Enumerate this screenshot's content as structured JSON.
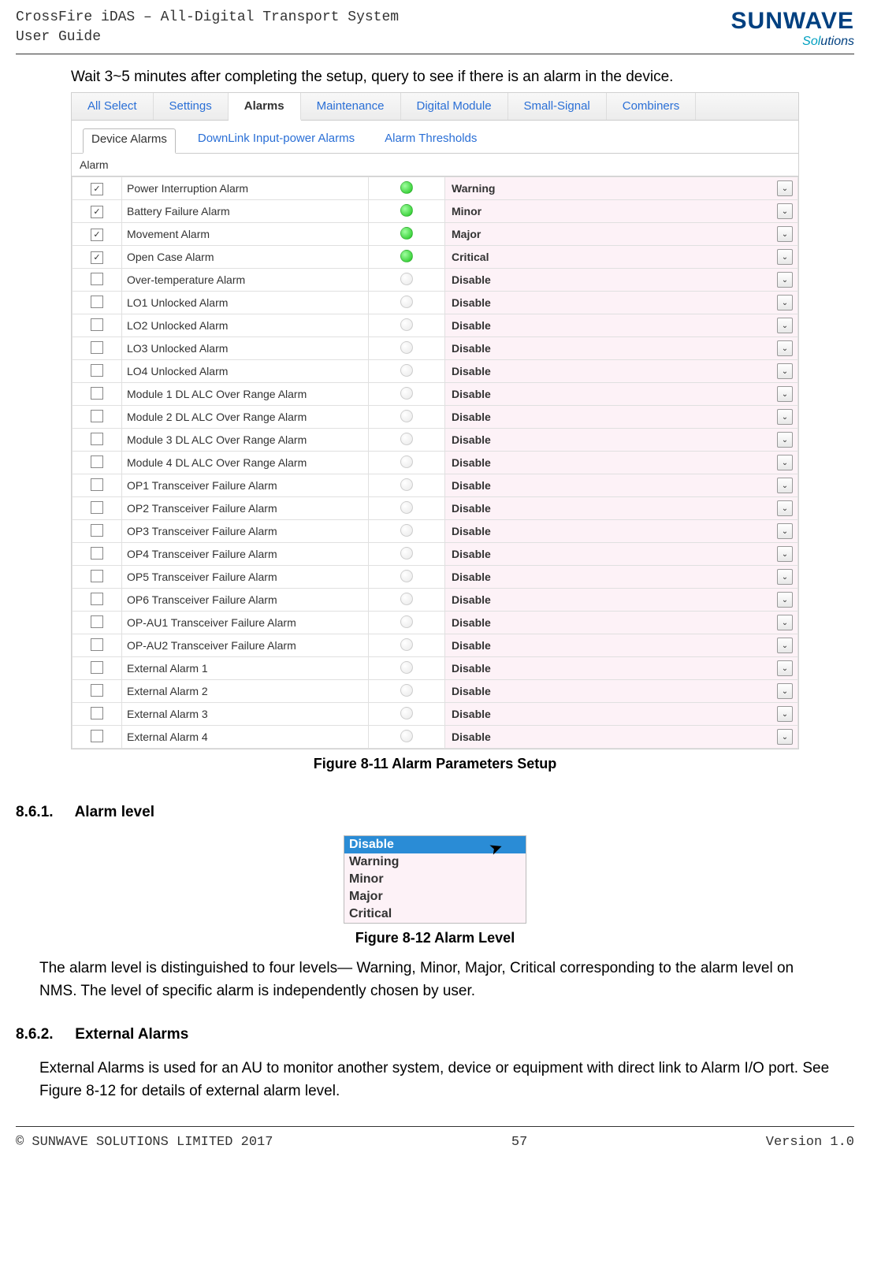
{
  "header": {
    "line1": "CrossFire iDAS – All-Digital Transport System",
    "line2": "User Guide",
    "logo_main": "SUNWAVE",
    "logo_sub_a": "Sol",
    "logo_sub_b": "utions"
  },
  "intro": "Wait 3~5 minutes after completing the setup, query to see if there is an alarm in the device.",
  "tabs": {
    "all_select": "All Select",
    "settings": "Settings",
    "alarms": "Alarms",
    "maintenance": "Maintenance",
    "digital_module": "Digital Module",
    "small_signal": "Small-Signal",
    "combiners": "Combiners"
  },
  "subtabs": {
    "device_alarms": "Device Alarms",
    "downlink": "DownLink Input-power Alarms",
    "thresholds": "Alarm Thresholds"
  },
  "alarm_section_label": "Alarm",
  "alarms": [
    {
      "checked": true,
      "name": "Power Interruption Alarm",
      "led": "green",
      "level": "Warning"
    },
    {
      "checked": true,
      "name": "Battery Failure Alarm",
      "led": "green",
      "level": "Minor"
    },
    {
      "checked": true,
      "name": "Movement Alarm",
      "led": "green",
      "level": "Major"
    },
    {
      "checked": true,
      "name": "Open Case Alarm",
      "led": "green",
      "level": "Critical"
    },
    {
      "checked": false,
      "name": "Over-temperature Alarm",
      "led": "off",
      "level": "Disable"
    },
    {
      "checked": false,
      "name": "LO1 Unlocked Alarm",
      "led": "off",
      "level": "Disable"
    },
    {
      "checked": false,
      "name": "LO2 Unlocked Alarm",
      "led": "off",
      "level": "Disable"
    },
    {
      "checked": false,
      "name": "LO3 Unlocked Alarm",
      "led": "off",
      "level": "Disable"
    },
    {
      "checked": false,
      "name": "LO4 Unlocked Alarm",
      "led": "off",
      "level": "Disable"
    },
    {
      "checked": false,
      "name": "Module 1 DL ALC Over Range Alarm",
      "led": "off",
      "level": "Disable"
    },
    {
      "checked": false,
      "name": "Module 2 DL ALC Over Range Alarm",
      "led": "off",
      "level": "Disable"
    },
    {
      "checked": false,
      "name": "Module 3 DL ALC Over Range Alarm",
      "led": "off",
      "level": "Disable"
    },
    {
      "checked": false,
      "name": "Module 4 DL ALC Over Range Alarm",
      "led": "off",
      "level": "Disable"
    },
    {
      "checked": false,
      "name": "OP1 Transceiver Failure Alarm",
      "led": "off",
      "level": "Disable"
    },
    {
      "checked": false,
      "name": "OP2 Transceiver Failure Alarm",
      "led": "off",
      "level": "Disable"
    },
    {
      "checked": false,
      "name": "OP3 Transceiver Failure Alarm",
      "led": "off",
      "level": "Disable"
    },
    {
      "checked": false,
      "name": "OP4 Transceiver Failure Alarm",
      "led": "off",
      "level": "Disable"
    },
    {
      "checked": false,
      "name": "OP5 Transceiver Failure Alarm",
      "led": "off",
      "level": "Disable"
    },
    {
      "checked": false,
      "name": "OP6 Transceiver Failure Alarm",
      "led": "off",
      "level": "Disable"
    },
    {
      "checked": false,
      "name": "OP-AU1 Transceiver Failure Alarm",
      "led": "off",
      "level": "Disable"
    },
    {
      "checked": false,
      "name": "OP-AU2 Transceiver Failure Alarm",
      "led": "off",
      "level": "Disable"
    },
    {
      "checked": false,
      "name": "External Alarm 1",
      "led": "off",
      "level": "Disable"
    },
    {
      "checked": false,
      "name": "External Alarm 2",
      "led": "off",
      "level": "Disable"
    },
    {
      "checked": false,
      "name": "External Alarm 3",
      "led": "off",
      "level": "Disable"
    },
    {
      "checked": false,
      "name": "External Alarm 4",
      "led": "off",
      "level": "Disable"
    }
  ],
  "fig1_caption": "Figure 8-11 Alarm Parameters Setup",
  "section1": {
    "num": "8.6.1.",
    "title": "Alarm level"
  },
  "dropdown_options": {
    "o0": "Disable",
    "o1": "Warning",
    "o2": "Minor",
    "o3": "Major",
    "o4": "Critical"
  },
  "fig2_caption": "Figure 8-12 Alarm Level",
  "para1": "The alarm level is distinguished to four levels— Warning, Minor, Major, Critical corresponding to the alarm level on NMS. The level of specific alarm is independently chosen by user.",
  "section2": {
    "num": "8.6.2.",
    "title": "External Alarms"
  },
  "para2": "External Alarms is used for an AU to monitor another system, device or equipment with direct link to Alarm I/O port. See Figure 8-12 for details of external alarm level.",
  "footer": {
    "left": "© SUNWAVE SOLUTIONS LIMITED 2017",
    "center": "57",
    "right": "Version 1.0"
  }
}
